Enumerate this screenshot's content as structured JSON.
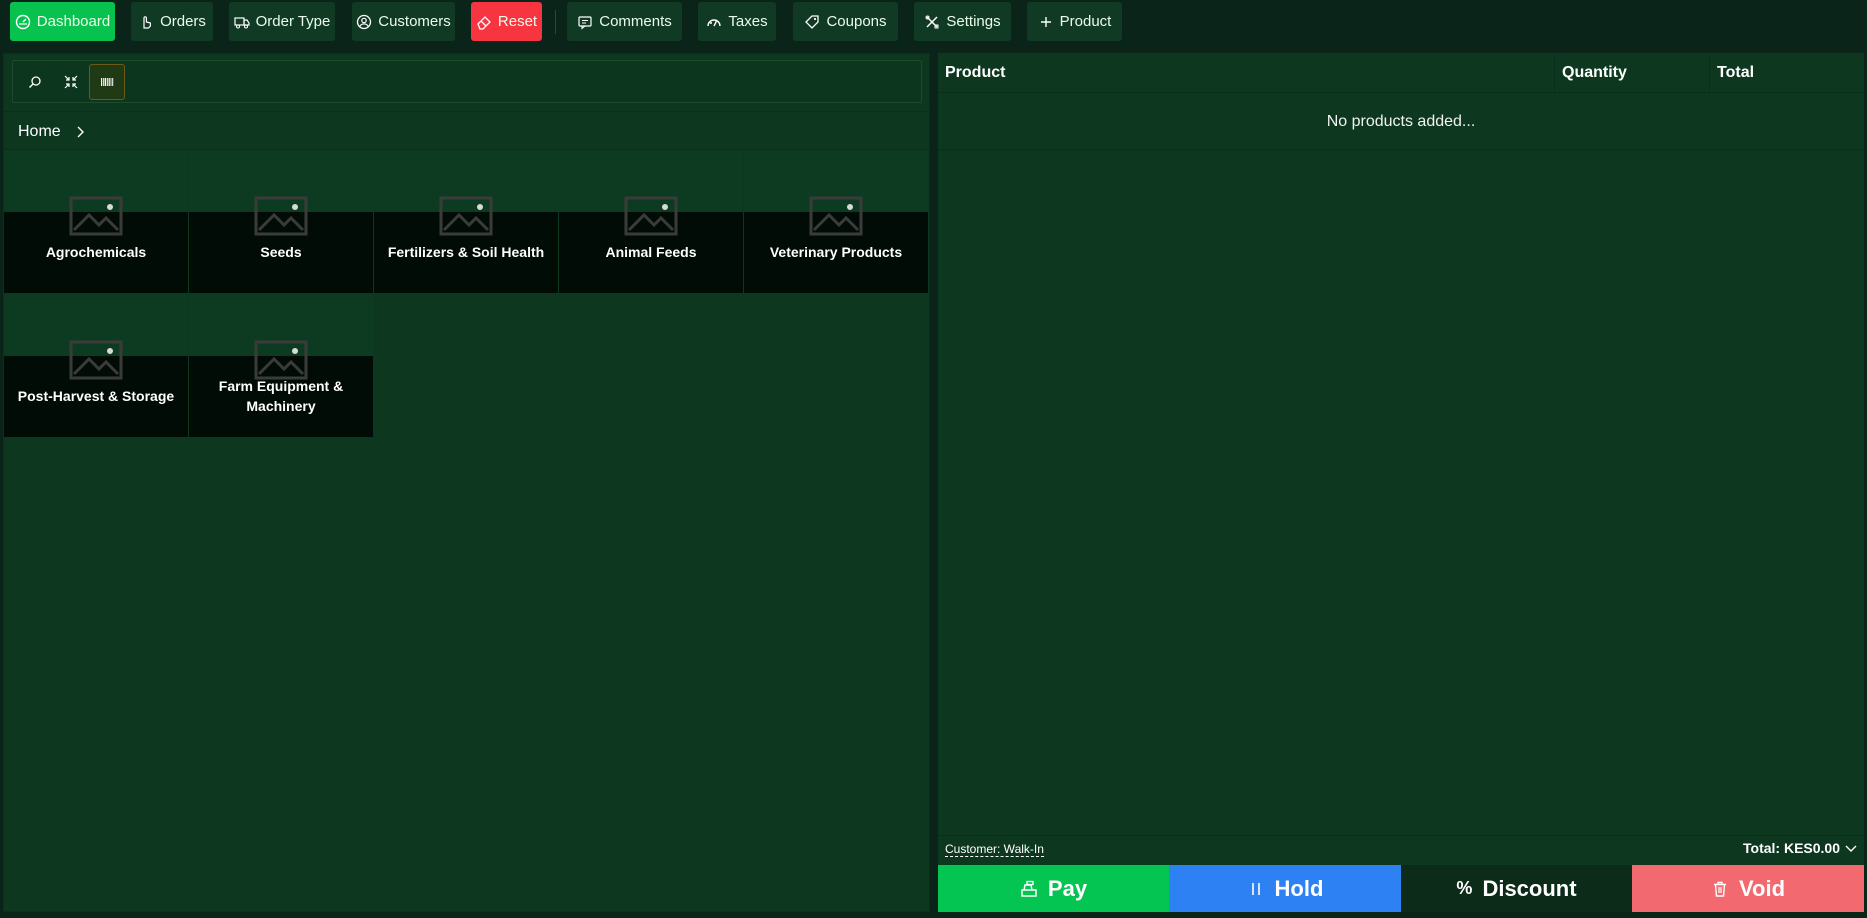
{
  "toolbar": {
    "buttons": [
      {
        "label": "Dashboard",
        "icon": "gauge-icon"
      },
      {
        "label": "Orders",
        "icon": "hand-pointer-icon"
      },
      {
        "label": "Order Type",
        "icon": "truck-icon"
      },
      {
        "label": "Customers",
        "icon": "user-circle-icon"
      },
      {
        "label": "Reset",
        "icon": "eraser-icon"
      },
      {
        "label": "Comments",
        "icon": "comment-icon"
      },
      {
        "label": "Taxes",
        "icon": "tax-icon"
      },
      {
        "label": "Coupons",
        "icon": "tag-icon"
      },
      {
        "label": "Settings",
        "icon": "tools-icon"
      },
      {
        "label": "Product",
        "icon": "plus-icon"
      }
    ],
    "colors": {
      "dashboard": "#07c24f",
      "reset": "#f73540"
    }
  },
  "search": {
    "modes": [
      "search-icon",
      "compress-icon",
      "barcode-icon"
    ],
    "active_mode": "barcode-icon"
  },
  "breadcrumb": {
    "home": "Home"
  },
  "categories": [
    {
      "label": "Agrochemicals"
    },
    {
      "label": "Seeds"
    },
    {
      "label": "Fertilizers & Soil Health"
    },
    {
      "label": "Animal Feeds"
    },
    {
      "label": "Veterinary Products"
    },
    {
      "label": "Post-Harvest & Storage"
    },
    {
      "label": "Farm Equipment & Machinery"
    }
  ],
  "cart": {
    "columns": {
      "product": "Product",
      "quantity": "Quantity",
      "total": "Total"
    },
    "empty_message": "No products added...",
    "customer_label": "Customer: Walk-In",
    "total_label": "Total: KES0.00"
  },
  "actions": {
    "pay": "Pay",
    "hold": "Hold",
    "discount": "Discount",
    "discount_symbol": "%",
    "void": "Void"
  }
}
